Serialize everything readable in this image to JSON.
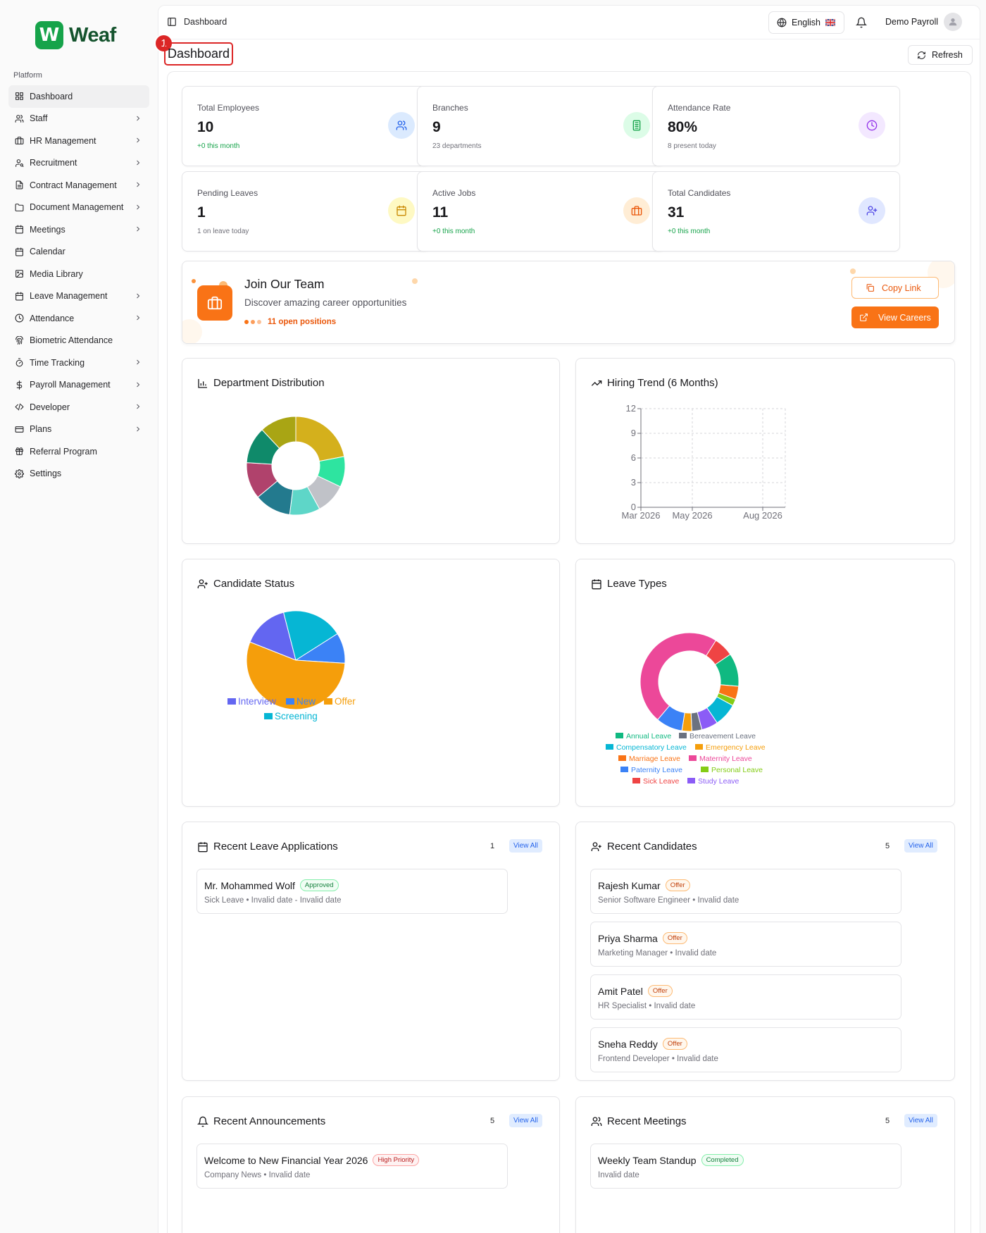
{
  "app": {
    "logo_letter": "W",
    "logo_text": "Weaf",
    "brand_color": "#16a34a"
  },
  "sidebar": {
    "section_label": "Platform",
    "items": [
      {
        "label": "Dashboard",
        "icon": "grid-icon",
        "chevron": false,
        "active": true
      },
      {
        "label": "Staff",
        "icon": "users-icon",
        "chevron": true
      },
      {
        "label": "HR Management",
        "icon": "briefcase-icon",
        "chevron": true
      },
      {
        "label": "Recruitment",
        "icon": "user-search-icon",
        "chevron": true
      },
      {
        "label": "Contract Management",
        "icon": "file-text-icon",
        "chevron": true
      },
      {
        "label": "Document Management",
        "icon": "folder-icon",
        "chevron": true
      },
      {
        "label": "Meetings",
        "icon": "calendar-icon",
        "chevron": true
      },
      {
        "label": "Calendar",
        "icon": "calendar-icon",
        "chevron": false
      },
      {
        "label": "Media Library",
        "icon": "image-icon",
        "chevron": false
      },
      {
        "label": "Leave Management",
        "icon": "calendar-icon",
        "chevron": true
      },
      {
        "label": "Attendance",
        "icon": "clock-icon",
        "chevron": true
      },
      {
        "label": "Biometric Attendance",
        "icon": "fingerprint-icon",
        "chevron": false
      },
      {
        "label": "Time Tracking",
        "icon": "timer-icon",
        "chevron": true
      },
      {
        "label": "Payroll Management",
        "icon": "dollar-icon",
        "chevron": true
      },
      {
        "label": "Developer",
        "icon": "code-icon",
        "chevron": true
      },
      {
        "label": "Plans",
        "icon": "credit-card-icon",
        "chevron": true
      },
      {
        "label": "Referral Program",
        "icon": "gift-icon",
        "chevron": false
      },
      {
        "label": "Settings",
        "icon": "gear-icon",
        "chevron": false
      }
    ]
  },
  "topbar": {
    "breadcrumb": "Dashboard",
    "language": "English",
    "user_name": "Demo Payroll"
  },
  "page": {
    "title": "Dashboard",
    "annotation_number": "1",
    "refresh_label": "Refresh"
  },
  "stats": [
    {
      "label": "Total Employees",
      "value": "10",
      "sub": "+0 this month",
      "sub_green": true,
      "icon": "users-icon",
      "icon_bg": "#dbeafe",
      "icon_color": "#2563eb"
    },
    {
      "label": "Branches",
      "value": "9",
      "sub": "23 departments",
      "sub_green": false,
      "icon": "building-icon",
      "icon_bg": "#dcfce7",
      "icon_color": "#16a34a"
    },
    {
      "label": "Attendance Rate",
      "value": "80%",
      "sub": "8 present today",
      "sub_green": false,
      "icon": "clock-icon",
      "icon_bg": "#f3e8ff",
      "icon_color": "#9333ea"
    },
    {
      "label": "Pending Leaves",
      "value": "1",
      "sub": "1 on leave today",
      "sub_green": false,
      "icon": "calendar-icon",
      "icon_bg": "#fef9c3",
      "icon_color": "#ca8a04"
    },
    {
      "label": "Active Jobs",
      "value": "11",
      "sub": "+0 this month",
      "sub_green": true,
      "icon": "briefcase-icon",
      "icon_bg": "#ffedd5",
      "icon_color": "#ea580c"
    },
    {
      "label": "Total Candidates",
      "value": "31",
      "sub": "+0 this month",
      "sub_green": true,
      "icon": "user-plus-icon",
      "icon_bg": "#e0e7ff",
      "icon_color": "#4f46e5"
    }
  ],
  "careers": {
    "title": "Join Our Team",
    "subtitle": "Discover amazing career opportunities",
    "open_positions": "11 open positions",
    "copy_link": "Copy Link",
    "view_careers": "View Careers"
  },
  "sections": {
    "dept_title": "Department Distribution",
    "hiring_title": "Hiring Trend (6 Months)",
    "candidate_title": "Candidate Status",
    "leave_types_title": "Leave Types",
    "recent_leaves_title": "Recent Leave Applications",
    "recent_leaves_count": "1",
    "recent_candidates_title": "Recent Candidates",
    "recent_candidates_count": "5",
    "announcements_title": "Recent Announcements",
    "announcements_count": "5",
    "meetings_title": "Recent Meetings",
    "meetings_count": "5",
    "view_all": "View All"
  },
  "recent_leaves": [
    {
      "name": "Mr. Mohammed Wolf",
      "status": "Approved",
      "status_color": "green",
      "sub": "Sick Leave • Invalid date - Invalid date"
    }
  ],
  "recent_candidates": [
    {
      "name": "Rajesh Kumar",
      "status": "Offer",
      "sub": "Senior Software Engineer • Invalid date"
    },
    {
      "name": "Priya Sharma",
      "status": "Offer",
      "sub": "Marketing Manager • Invalid date"
    },
    {
      "name": "Amit Patel",
      "status": "Offer",
      "sub": "HR Specialist • Invalid date"
    },
    {
      "name": "Sneha Reddy",
      "status": "Offer",
      "sub": "Frontend Developer • Invalid date"
    }
  ],
  "announcements": [
    {
      "title": "Welcome to New Financial Year 2026",
      "tag": "High Priority",
      "sub": "Company News • Invalid date"
    }
  ],
  "meetings": [
    {
      "title": "Weekly Team Standup",
      "tag": "Completed",
      "sub": "Invalid date"
    }
  ],
  "chart_data": [
    {
      "type": "pie",
      "variant": "donut",
      "values": [
        22,
        10,
        10,
        10,
        12,
        12,
        12,
        12
      ],
      "colors": [
        "#d4b01c",
        "#2ee4a0",
        "#c0c2c8",
        "#5ed6c8",
        "#237a8e",
        "#b0426c",
        "#0f8a6a",
        "#a9a514"
      ]
    },
    {
      "type": "line",
      "categories": [
        "Mar 2026",
        "May 2026",
        "Aug 2026"
      ],
      "ylim": [
        0,
        12
      ],
      "yticks": [
        0,
        3,
        6,
        9,
        12
      ],
      "grid": true
    },
    {
      "type": "pie",
      "labels": [
        "Interview",
        "New",
        "Offer",
        "Screening"
      ],
      "values": [
        15,
        10,
        55,
        20
      ],
      "colors": [
        "#6366f1",
        "#3b82f6",
        "#f59e0b",
        "#06b6d4"
      ],
      "legend": "bottom"
    },
    {
      "type": "pie",
      "variant": "donut",
      "labels": [
        "Annual Leave",
        "Bereavement Leave",
        "Compensatory Leave",
        "Emergency Leave",
        "Marriage Leave",
        "Maternity Leave",
        "Paternity Leave",
        "Personal Leave",
        "Sick Leave",
        "Study Leave"
      ],
      "values": [
        10,
        3,
        7,
        3,
        4,
        44,
        8,
        2,
        6,
        5
      ],
      "colors": [
        "#10b981",
        "#6b7280",
        "#06b6d4",
        "#f59e0b",
        "#f97316",
        "#ec4899",
        "#3b82f6",
        "#84cc16",
        "#ef4444",
        "#8b5cf6"
      ],
      "legend": "bottom"
    }
  ]
}
